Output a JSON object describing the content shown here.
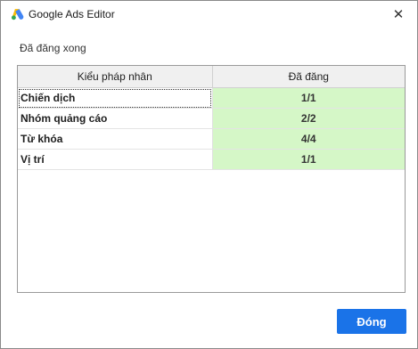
{
  "window": {
    "title": "Google Ads Editor",
    "close_label": "✕"
  },
  "status_text": "Đã đăng xong",
  "table": {
    "headers": [
      "Kiểu pháp nhân",
      "Đã đăng"
    ],
    "rows": [
      {
        "kind": "Chiến dịch",
        "posted": "1/1"
      },
      {
        "kind": "Nhóm quảng cáo",
        "posted": "2/2"
      },
      {
        "kind": "Từ khóa",
        "posted": "4/4"
      },
      {
        "kind": "Vị trí",
        "posted": "1/1"
      }
    ]
  },
  "buttons": {
    "close_label": "Đóng"
  },
  "colors": {
    "accent": "#1a73e8",
    "success_cell": "#d5f7c7"
  },
  "icons": {
    "logo": "google-ads-logo-icon",
    "close": "close-icon"
  }
}
